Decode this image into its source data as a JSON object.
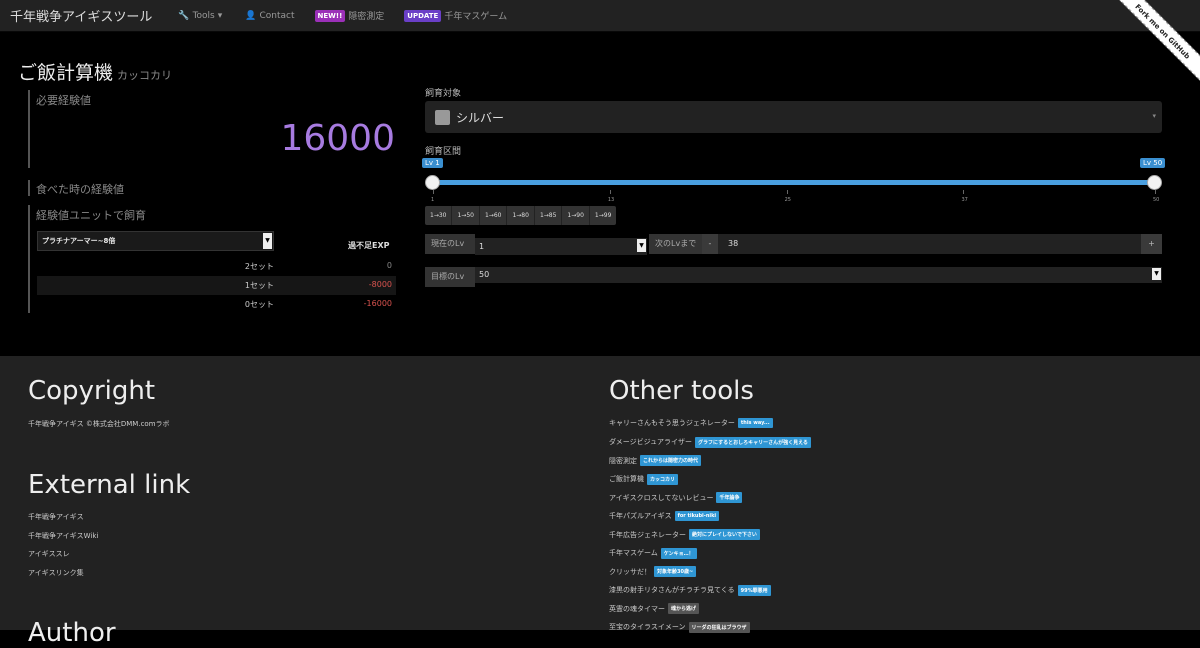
{
  "nav": {
    "brand": "千年戦争アイギスツール",
    "tools": "Tools",
    "contact": "Contact",
    "new_badge": "NEW!!",
    "hidden": "隠密測定",
    "update_badge": "UPDATE",
    "game": "千年マスゲーム",
    "ribbon": "Fork me on GitHub"
  },
  "page": {
    "title": "ご飯計算機",
    "subtitle": "カッコカリ"
  },
  "left": {
    "needed_label": "必要経験値",
    "needed_value": "16000",
    "ate_label": "食べた時の経験値",
    "unit_label": "経験値ユニットで飼育",
    "unit_select": "プラチナアーマー~8倍",
    "exp_header": "過不足EXP",
    "rows": [
      {
        "sets": "2セット",
        "exp": "0"
      },
      {
        "sets": "1セット",
        "exp": "-8000"
      },
      {
        "sets": "0セット",
        "exp": "-16000"
      }
    ]
  },
  "right": {
    "target_label": "飼育対象",
    "target_value": "シルバー",
    "range_label": "飼育区間",
    "lv_min": "Lv 1",
    "lv_max": "Lv 50",
    "slider": {
      "from": 1,
      "to": 50,
      "min": 1,
      "max": 50
    },
    "ticks": [
      "1",
      "13",
      "25",
      "37",
      "50"
    ],
    "quick": [
      "1→30",
      "1→50",
      "1→60",
      "1→80",
      "1→85",
      "1→90",
      "1→99"
    ],
    "cur_lv_label": "現在のLv",
    "cur_lv_value": "1",
    "next_label": "次のLvまで",
    "minus": "-",
    "next_value": "38",
    "plus": "+",
    "goal_label": "目標のLv",
    "goal_value": "50"
  },
  "footer": {
    "copyright_h": "Copyright",
    "copyright_t": "千年戦争アイギス ©株式会社DMM.comラボ",
    "external_h": "External link",
    "links": [
      "千年戦争アイギス",
      "千年戦争アイギスWiki",
      "アイギススレ",
      "アイギスリンク集"
    ],
    "author_h": "Author",
    "other_h": "Other tools",
    "tools": [
      {
        "name": "キャリーさんもそう思うジェネレーター",
        "tag": "this way..."
      },
      {
        "name": "ダメージビジュアライザー",
        "tag": "グラフにするとおしろキャリーさんが強く見える"
      },
      {
        "name": "隠密測定",
        "tag": "これからは隠密力の時代"
      },
      {
        "name": "ご飯計算機",
        "tag": "カッコカリ"
      },
      {
        "name": "アイギスクロスしてないレビュー",
        "tag": "千年論争"
      },
      {
        "name": "千年パズルアイギス",
        "tag": "for tikubi-niki"
      },
      {
        "name": "千年広告ジェネレーター",
        "tag": "絶対にプレイしないで下さい"
      },
      {
        "name": "千年マスゲーム",
        "tag": "ケンキョ…！"
      },
      {
        "name": "クリッサだ！",
        "tag": "対象年齢30歳~"
      },
      {
        "name": "漆黒の射手リタさんがチラチラ見てくる",
        "tag": "99%罪悪用"
      },
      {
        "name": "英霊の魂タイマー",
        "tag": "魂から逃げ",
        "gray": true
      },
      {
        "name": "至宝のタイラスイメーン",
        "tag": "リーダの狂乱はブラウザ",
        "gray": true
      }
    ]
  }
}
